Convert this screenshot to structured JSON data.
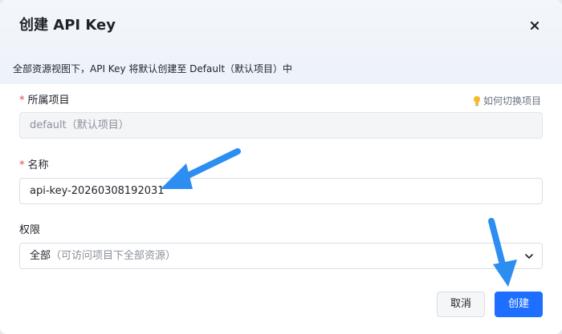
{
  "dialog": {
    "title": "创建 API Key",
    "close_icon": "close-icon"
  },
  "notice": {
    "text": "全部资源视图下，API Key 将默认创建至 Default（默认项目）中"
  },
  "project": {
    "required_mark": "*",
    "label": "所属项目",
    "hint_icon": "lightbulb-icon",
    "hint": "如何切换项目",
    "value": "default（默认项目）"
  },
  "name": {
    "required_mark": "*",
    "label": "名称",
    "value": "api-key-20260308192031"
  },
  "permission": {
    "label": "权限",
    "value_main": "全部",
    "value_sub": "（可访问项目下全部资源）",
    "chevron_icon": "chevron-down-icon"
  },
  "footer": {
    "cancel_label": "取消",
    "create_label": "创建"
  },
  "colors": {
    "primary": "#1e6fff",
    "required": "#e5484d",
    "annotation_arrow": "#2b8ef0"
  }
}
